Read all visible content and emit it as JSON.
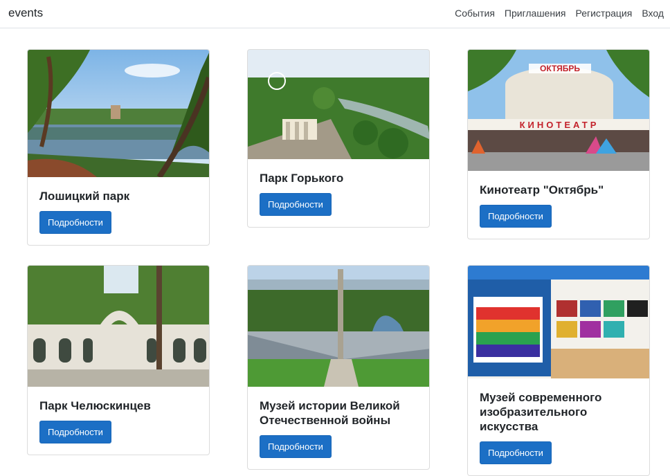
{
  "navbar": {
    "brand": "events",
    "links": [
      "События",
      "Приглашения",
      "Регистрация",
      "Вход"
    ]
  },
  "cards": [
    {
      "title": "Лошицкий парк",
      "button": "Подробности",
      "image": "lake-park-photo"
    },
    {
      "title": "Парк Горького",
      "button": "Подробности",
      "image": "aerial-park-photo"
    },
    {
      "title": "Кинотеатр \"Октябрь\"",
      "button": "Подробности",
      "image": "cinema-building-photo"
    },
    {
      "title": "Парк Челюскинцев",
      "button": "Подробности",
      "image": "park-arch-gate-photo"
    },
    {
      "title": "Музей истории Великой Отечественной войны",
      "button": "Подробности",
      "image": "war-museum-photo"
    },
    {
      "title": "Музей современного изобразительного искусства",
      "button": "Подробности",
      "image": "art-gallery-photo"
    }
  ],
  "colors": {
    "button": "#1c6fc5",
    "border": "#dee2e6"
  }
}
